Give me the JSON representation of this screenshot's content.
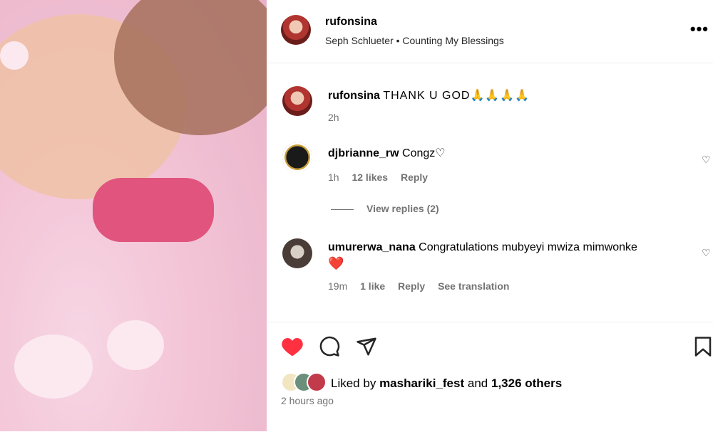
{
  "post": {
    "author": "rufonsina",
    "subtitle": "Seph Schlueter • Counting My Blessings",
    "more_icon": "more-horizontal-icon"
  },
  "caption": {
    "username": "rufonsina",
    "text": "THANK U GOD🙏🙏🙏🙏",
    "time": "2h"
  },
  "comments": [
    {
      "username": "djbrianne_rw",
      "text": "Congz♡",
      "time": "1h",
      "likes": "12 likes",
      "reply": "Reply",
      "view_replies": "View replies (2)"
    },
    {
      "username": "umurerwa_nana",
      "text": "Congratulations mubyeyi mwiza mimwonke",
      "emoji": "❤️",
      "time": "19m",
      "likes": "1 like",
      "reply": "Reply",
      "translation": "See translation"
    }
  ],
  "likes": {
    "prefix": "Liked by",
    "user": "mashariki_fest",
    "and": "and",
    "count": "1,326 others",
    "time_ago": "2 hours ago"
  },
  "colors": {
    "heart": "#ff3040",
    "muted": "#737373"
  }
}
